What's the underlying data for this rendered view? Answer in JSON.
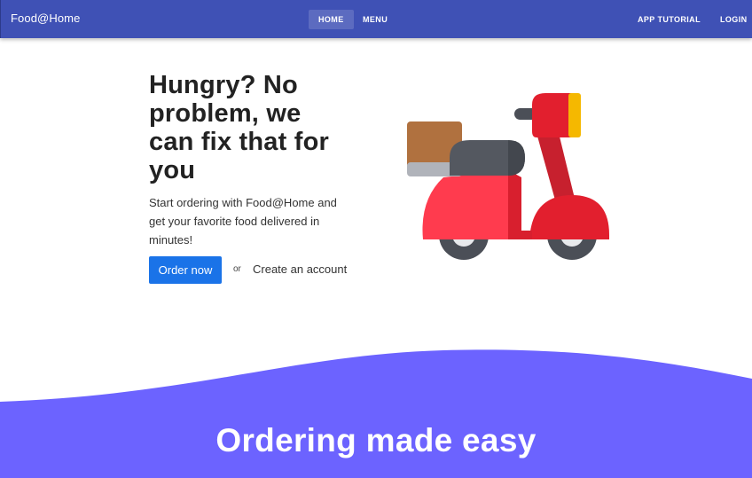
{
  "navbar": {
    "brand": "Food@Home",
    "links": {
      "home": "HOME",
      "menu": "MENU",
      "tutorial": "APP TUTORIAL",
      "login": "LOGIN"
    },
    "color": "#3f51b5",
    "active_color": "#5c6bc0"
  },
  "hero": {
    "title": "Hungry? No problem, we can fix that for you",
    "subtitle": "Start ordering with Food@Home and get your favorite food delivered in minutes!",
    "primary_button": "Order now",
    "or_text": "or",
    "secondary_link": "Create an account",
    "primary_color": "#1a73e8",
    "illustration": "delivery-scooter-icon"
  },
  "features": {
    "title": "Ordering made easy",
    "band_color": "#6c63ff"
  }
}
